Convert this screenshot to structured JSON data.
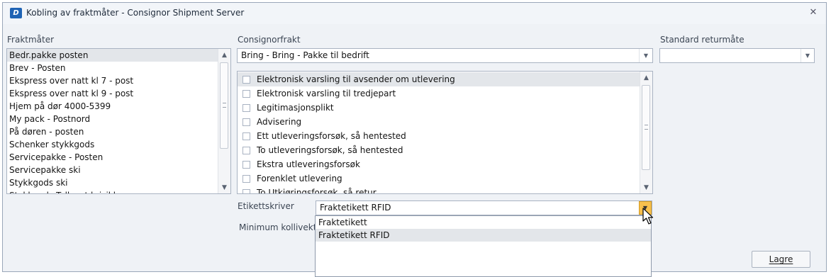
{
  "window": {
    "title": "Kobling av fraktmåter - Consignor Shipment Server",
    "icon": "consignor-logo",
    "close_icon": "close-icon",
    "app_icon_text": "D"
  },
  "fraktmater": {
    "label": "Fraktmåter",
    "items": [
      "Bedr.pakke posten",
      "Brev - Posten",
      "Ekspress over natt kl 7 - post",
      "Ekspress over natt kl 9 - post",
      "Hjem på dør 4000-5399",
      "My pack - Postnord",
      "På døren - posten",
      "Schenker stykkgods",
      "Servicepakke - Posten",
      "Servicepakke ski",
      "Stykkgods ski",
      "Stykkgods Tollpost krisikk"
    ],
    "selected_index": 0
  },
  "consignorfrakt": {
    "label": "Consignorfrakt",
    "value": "Bring - Bring - Pakke til bedrift"
  },
  "options": {
    "items": [
      "Elektronisk varsling til avsender om utlevering",
      "Elektronisk varsling til tredjepart",
      "Legitimasjonsplikt",
      "Advisering",
      "Ett utleveringsforsøk, så hentested",
      "To utleveringsforsøk, så hentested",
      "Ekstra utleveringsforsøk",
      "Forenklet utlevering",
      "To Utkjøringsforsøk, så retur"
    ],
    "selected_index": 0
  },
  "standard_returmate": {
    "label": "Standard returmåte",
    "value": ""
  },
  "etikettskriver": {
    "label": "Etikettskriver",
    "value": "Fraktetikett RFID",
    "options": [
      "Fraktetikett",
      "Fraktetikett RFID"
    ],
    "hover_index": 1
  },
  "minimum_kollivekt": {
    "label": "Minimum kollivekt"
  },
  "buttons": {
    "save_label": "Lagre"
  },
  "colors": {
    "window_bg": "#eff2f6",
    "selection": "#e3e6ea",
    "dropdown_hot": "#f7c04e",
    "app_icon": "#1f63b4"
  }
}
